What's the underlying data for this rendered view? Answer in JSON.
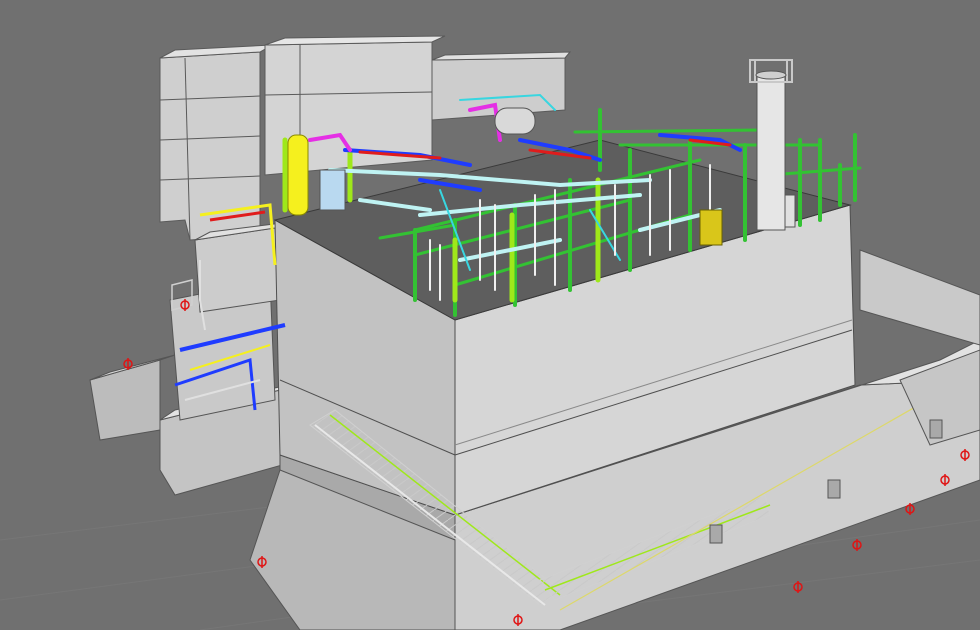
{
  "viewport": {
    "background_color": "#707070",
    "grid_line_color": "#7b7b7b"
  },
  "palette": {
    "structure_light": "#d8d8d8",
    "structure_mid": "#bdbdbd",
    "structure_dark": "#9a9a9a",
    "edge": "#555555",
    "steel_green": "#33c233",
    "steel_lime": "#9fe81a",
    "pipe_blue": "#1f3cff",
    "pipe_red": "#e01c1c",
    "pipe_magenta": "#e52fe5",
    "pipe_cyan": "#38d6e0",
    "vessel_yellow": "#f5f01e",
    "marker_red": "#e01414"
  },
  "scene": {
    "description_icons": [
      "building-block",
      "pipe-rack",
      "stack-chimney",
      "grid-marker"
    ],
    "grid_markers_count": 9
  }
}
